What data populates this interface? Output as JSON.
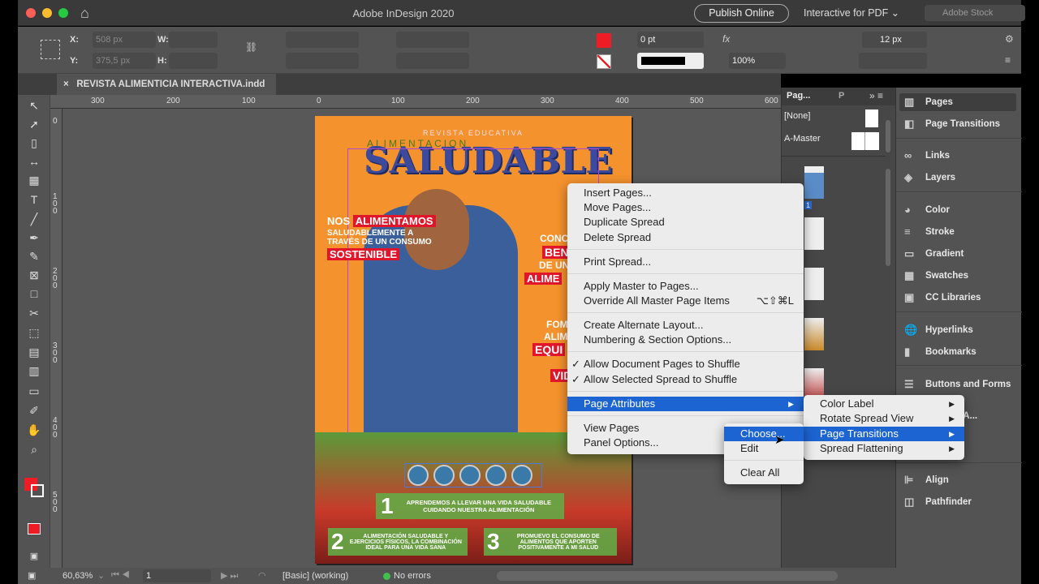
{
  "window": {
    "title": "Adobe InDesign 2020",
    "publish": "Publish Online",
    "workspace": "Interactive for PDF ⌄",
    "search_placeholder": "Adobe Stock"
  },
  "control": {
    "x_label": "X:",
    "x_value": "508 px",
    "y_label": "Y:",
    "y_value": "375,5 px",
    "w_label": "W:",
    "h_label": "H:",
    "stroke_weight": "0 pt",
    "opacity": "100%",
    "gap": "12 px",
    "fill_color": "#ee1c25"
  },
  "tab": {
    "close": "×",
    "title": "REVISTA ALIMENTICIA INTERACTIVA.indd @ 61%"
  },
  "ruler": {
    "h": [
      "300",
      "200",
      "100",
      "0",
      "100",
      "200",
      "300",
      "400",
      "500",
      "600"
    ],
    "v": [
      "0",
      "100",
      "200",
      "300",
      "400",
      "500"
    ]
  },
  "artwork": {
    "kicker": "REVISTA EDUCATIVA",
    "subtitle": "ALIMENTACION",
    "title": "SALUDABLE",
    "l1": "NOS",
    "l2": "ALIMENTAMOS",
    "l3": "SALUDABLEMENTE A",
    "l4": "TRAVÉS DE UN CONSUMO",
    "l5": "SOSTENIBLE",
    "r1": "CONC",
    "r2": "BEN",
    "r3": "DE UN",
    "r4": "ALIME",
    "r5": "FOM",
    "r6": "ALIM",
    "r7": "EQUI",
    "r8": "VID",
    "b1n": "1",
    "b1": "APRENDEMOS A LLEVAR UNA VIDA SALUDABLE CUIDANDO NUESTRA ALIMENTACIÓN",
    "b2n": "2",
    "b2": "ALIMENTACIÓN SALUDABLE Y EJERCICIOS FÍSICOS, LA COMBINACIÓN IDEAL PARA UNA VIDA SANA",
    "b3n": "3",
    "b3": "PROMUEVO EL CONSUMO DE ALIMENTOS QUE APORTEN POSITIVAMENTE A MI SALUD"
  },
  "pages_panel": {
    "tab1": "Pag...",
    "tab2": "P",
    "none": "[None]",
    "master": "A-Master",
    "page1": "1",
    "a": "A"
  },
  "dock": [
    "Pages",
    "Page Transitions",
    "Links",
    "Layers",
    "Color",
    "Stroke",
    "Gradient",
    "Swatches",
    "CC Libraries",
    "Hyperlinks",
    "Bookmarks",
    "Buttons and Forms",
    "Buttons A...",
    "Align",
    "Pathfinder"
  ],
  "menu": {
    "items": [
      "Insert Pages...",
      "Move Pages...",
      "Duplicate Spread",
      "Delete Spread",
      "Print Spread...",
      "Apply Master to Pages...",
      "Override All Master Page Items",
      "Create Alternate Layout...",
      "Numbering & Section Options...",
      "Allow Document Pages to Shuffle",
      "Allow Selected Spread to Shuffle",
      "Page Attributes",
      "View Pages",
      "Panel Options..."
    ],
    "shortcut": "⌥⇧⌘L",
    "check": "✓"
  },
  "submenu": [
    "Color Label",
    "Rotate Spread View",
    "Page Transitions",
    "Spread Flattening"
  ],
  "submenu2": [
    "Choose...",
    "Edit",
    "Clear All"
  ],
  "status": {
    "zoom": "60,63%",
    "page": "1",
    "profile": "[Basic] (working)",
    "errors": "No errors",
    "error_color": "#3fc14a"
  }
}
